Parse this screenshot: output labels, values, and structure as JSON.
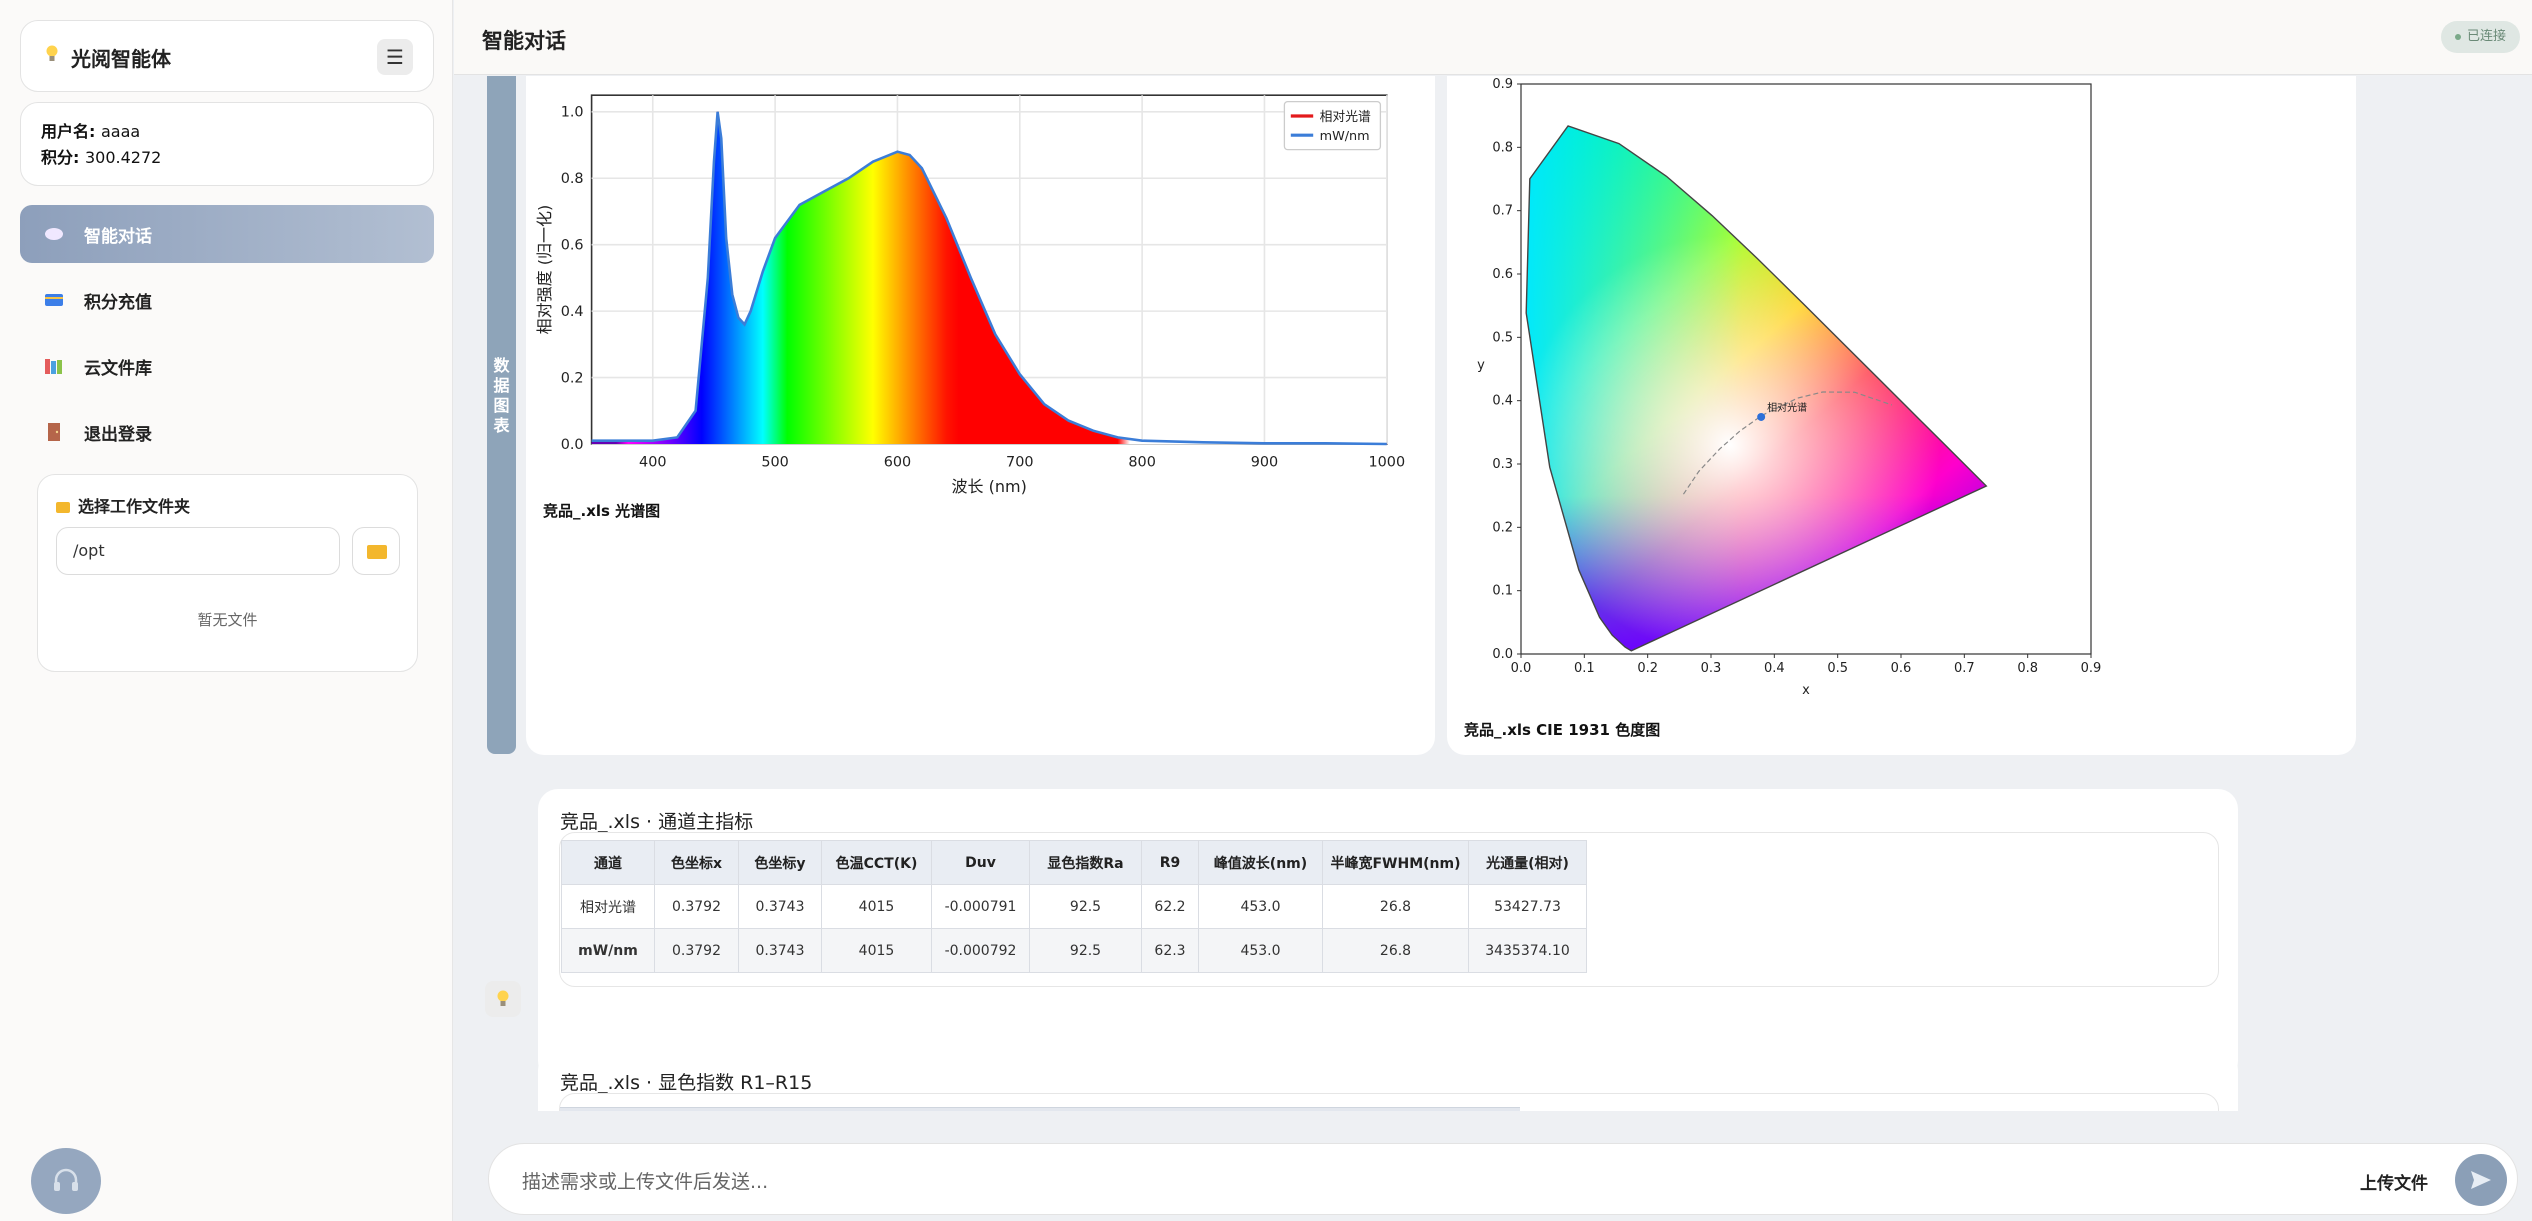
{
  "sidebar": {
    "brand": "光阅智能体",
    "menu_icon": "☰",
    "user": {
      "name_label": "用户名:",
      "name": "aaaa",
      "credit_label": "积分:",
      "credit": "300.4272"
    },
    "nav": [
      {
        "label": "智能对话",
        "icon": "chat-bubble-icon",
        "active": true
      },
      {
        "label": "积分充值",
        "icon": "credit-card-icon",
        "active": false
      },
      {
        "label": "云文件库",
        "icon": "books-icon",
        "active": false
      },
      {
        "label": "退出登录",
        "icon": "door-icon",
        "active": false
      }
    ],
    "folder": {
      "title": "选择工作文件夹",
      "path": "/opt",
      "empty": "暂无文件"
    }
  },
  "header": {
    "title": "智能对话",
    "status": "已连接"
  },
  "side_tag": "数据图表",
  "spectrum_chart": {
    "caption": "竞品_.xls 光谱图",
    "chart_data": {
      "type": "line",
      "xlabel": "波长 (nm)",
      "ylabel": "相对强度 (归一化)",
      "xlim": [
        350,
        1000
      ],
      "ylim": [
        0,
        1.05
      ],
      "xticks": [
        "400",
        "500",
        "600",
        "700",
        "800",
        "900",
        "1000"
      ],
      "yticks": [
        "0.0",
        "0.2",
        "0.4",
        "0.6",
        "0.8",
        "1.0"
      ],
      "legend_position": "top-right",
      "series": [
        {
          "name": "相对光谱",
          "color": "#e31a1c"
        },
        {
          "name": "mW/nm",
          "color": "#3b7dd8"
        }
      ],
      "x": [
        350,
        400,
        420,
        435,
        445,
        450,
        453,
        456,
        460,
        465,
        470,
        475,
        480,
        490,
        500,
        520,
        540,
        560,
        580,
        600,
        610,
        620,
        640,
        660,
        680,
        700,
        720,
        740,
        760,
        780,
        800,
        850,
        900,
        950,
        1000
      ],
      "y": [
        0.01,
        0.01,
        0.02,
        0.1,
        0.5,
        0.85,
        1.0,
        0.92,
        0.62,
        0.45,
        0.38,
        0.36,
        0.4,
        0.52,
        0.62,
        0.72,
        0.76,
        0.8,
        0.85,
        0.88,
        0.87,
        0.83,
        0.68,
        0.5,
        0.33,
        0.21,
        0.12,
        0.07,
        0.04,
        0.02,
        0.01,
        0.005,
        0.002,
        0.002,
        0.0
      ]
    }
  },
  "cie_chart": {
    "caption": "竞品_.xls CIE 1931 色度图",
    "chart_data": {
      "type": "scatter",
      "xlabel": "x",
      "ylabel": "y",
      "xlim": [
        0,
        0.9
      ],
      "ylim": [
        0,
        0.9
      ],
      "xticks": [
        "0.0",
        "0.1",
        "0.2",
        "0.3",
        "0.4",
        "0.5",
        "0.6",
        "0.7",
        "0.8",
        "0.9"
      ],
      "yticks": [
        "0.0",
        "0.1",
        "0.2",
        "0.3",
        "0.4",
        "0.5",
        "0.6",
        "0.7",
        "0.8",
        "0.9"
      ],
      "points": [
        {
          "label": "相对光谱",
          "x": 0.3792,
          "y": 0.3743
        }
      ],
      "locus": [
        [
          0.1741,
          0.005
        ],
        [
          0.1644,
          0.0109
        ],
        [
          0.144,
          0.0297
        ],
        [
          0.1241,
          0.0578
        ],
        [
          0.0913,
          0.1327
        ],
        [
          0.0454,
          0.295
        ],
        [
          0.0082,
          0.5384
        ],
        [
          0.0139,
          0.7502
        ],
        [
          0.0743,
          0.8338
        ],
        [
          0.1547,
          0.8059
        ],
        [
          0.2296,
          0.7543
        ],
        [
          0.3016,
          0.6923
        ],
        [
          0.3731,
          0.6245
        ],
        [
          0.4441,
          0.5547
        ],
        [
          0.5125,
          0.4866
        ],
        [
          0.5752,
          0.4242
        ],
        [
          0.627,
          0.3725
        ],
        [
          0.6658,
          0.334
        ],
        [
          0.7347,
          0.2653
        ]
      ],
      "planckian": [
        [
          0.2565,
          0.2523
        ],
        [
          0.2807,
          0.2883
        ],
        [
          0.3136,
          0.3236
        ],
        [
          0.3451,
          0.3516
        ],
        [
          0.3805,
          0.3768
        ],
        [
          0.4369,
          0.4041
        ],
        [
          0.4764,
          0.4137
        ],
        [
          0.5267,
          0.4133
        ],
        [
          0.5857,
          0.3932
        ]
      ]
    }
  },
  "metrics_table": {
    "title": "竞品_.xls · 通道主指标",
    "headers": [
      "通道",
      "色坐标x",
      "色坐标y",
      "色温CCT(K)",
      "Duv",
      "显色指数Ra",
      "R9",
      "峰值波长(nm)",
      "半峰宽FWHM(nm)",
      "光通量(相对)"
    ],
    "rows": [
      [
        "相对光谱",
        "0.3792",
        "0.3743",
        "4015",
        "-0.000791",
        "92.5",
        "62.2",
        "453.0",
        "26.8",
        "53427.73"
      ],
      [
        "mW/nm",
        "0.3792",
        "0.3743",
        "4015",
        "-0.000792",
        "92.5",
        "62.3",
        "453.0",
        "26.8",
        "3435374.10"
      ]
    ]
  },
  "cri_table": {
    "title": "竞品_.xls · 显色指数 R1–R15"
  },
  "input": {
    "placeholder": "描述需求或上传文件后发送...",
    "upload_label": "上传文件"
  }
}
